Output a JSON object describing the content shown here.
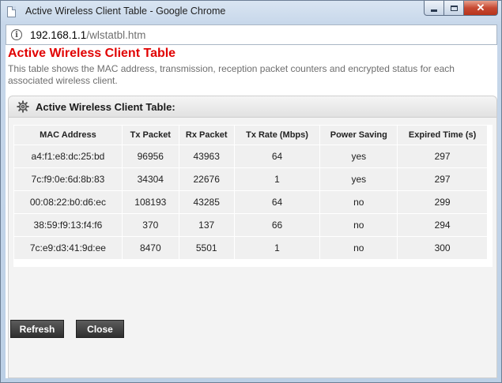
{
  "window": {
    "title": "Active Wireless Client Table - Google Chrome",
    "close_glyph": "✕"
  },
  "address_bar": {
    "host": "192.168.1.1",
    "path": "/wlstatbl.htm",
    "info_glyph": "i"
  },
  "page": {
    "title": "Active Wireless Client Table",
    "description": "This table shows the MAC address, transmission, reception packet counters and encrypted status for each associated wireless client."
  },
  "panel": {
    "title": "Active Wireless Client Table:"
  },
  "table": {
    "headers": [
      "MAC Address",
      "Tx Packet",
      "Rx Packet",
      "Tx Rate (Mbps)",
      "Power Saving",
      "Expired Time (s)"
    ],
    "rows": [
      [
        "a4:f1:e8:dc:25:bd",
        "96956",
        "43963",
        "64",
        "yes",
        "297"
      ],
      [
        "7c:f9:0e:6d:8b:83",
        "34304",
        "22676",
        "1",
        "yes",
        "297"
      ],
      [
        "00:08:22:b0:d6:ec",
        "108193",
        "43285",
        "64",
        "no",
        "299"
      ],
      [
        "38:59:f9:13:f4:f6",
        "370",
        "137",
        "66",
        "no",
        "294"
      ],
      [
        "7c:e9:d3:41:9d:ee",
        "8470",
        "5501",
        "1",
        "no",
        "300"
      ]
    ]
  },
  "buttons": {
    "refresh": "Refresh",
    "close": "Close"
  },
  "colors": {
    "title_red": "#e10000",
    "button_dark": "#2f2f2f",
    "cell_bg": "#f0f0f0"
  }
}
